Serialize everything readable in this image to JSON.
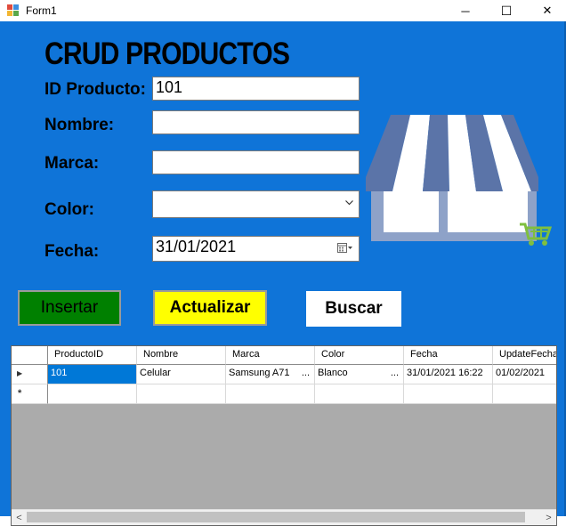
{
  "window": {
    "title": "Form1",
    "minimize_glyph": "─",
    "maximize_glyph": "☐",
    "close_glyph": "✕"
  },
  "form": {
    "heading": "CRUD PRODUCTOS",
    "id_label": "ID Producto:",
    "id_value": "101",
    "nombre_label": "Nombre:",
    "nombre_value": "",
    "marca_label": "Marca:",
    "marca_value": "",
    "color_label": "Color:",
    "color_value": "",
    "fecha_label": "Fecha:",
    "fecha_value": "31/01/2021"
  },
  "buttons": {
    "insertar": "Insertar",
    "actualizar": "Actualizar",
    "buscar": "Buscar"
  },
  "colors": {
    "background": "#0f74d8",
    "insertar": "#008000",
    "actualizar": "#ffff00",
    "buscar": "#ffffff",
    "cart": "#7fbf3f"
  },
  "grid": {
    "columns": [
      "ProductoID",
      "Nombre",
      "Marca",
      "Color",
      "Fecha",
      "UpdateFecha"
    ],
    "rows": [
      [
        "101",
        "Celular",
        "Samsung A71",
        "Blanco",
        "31/01/2021 16:22",
        "01/02/2021"
      ]
    ],
    "ellipsis": "...",
    "current_row_marker": "▶",
    "new_row_marker": "*",
    "scroll_left": "<",
    "scroll_right": ">"
  },
  "icons": {
    "store": "store-awning-icon",
    "cart": "shopping-cart-icon",
    "calendar": "calendar-icon",
    "dropdown": "chevron-down-icon"
  }
}
